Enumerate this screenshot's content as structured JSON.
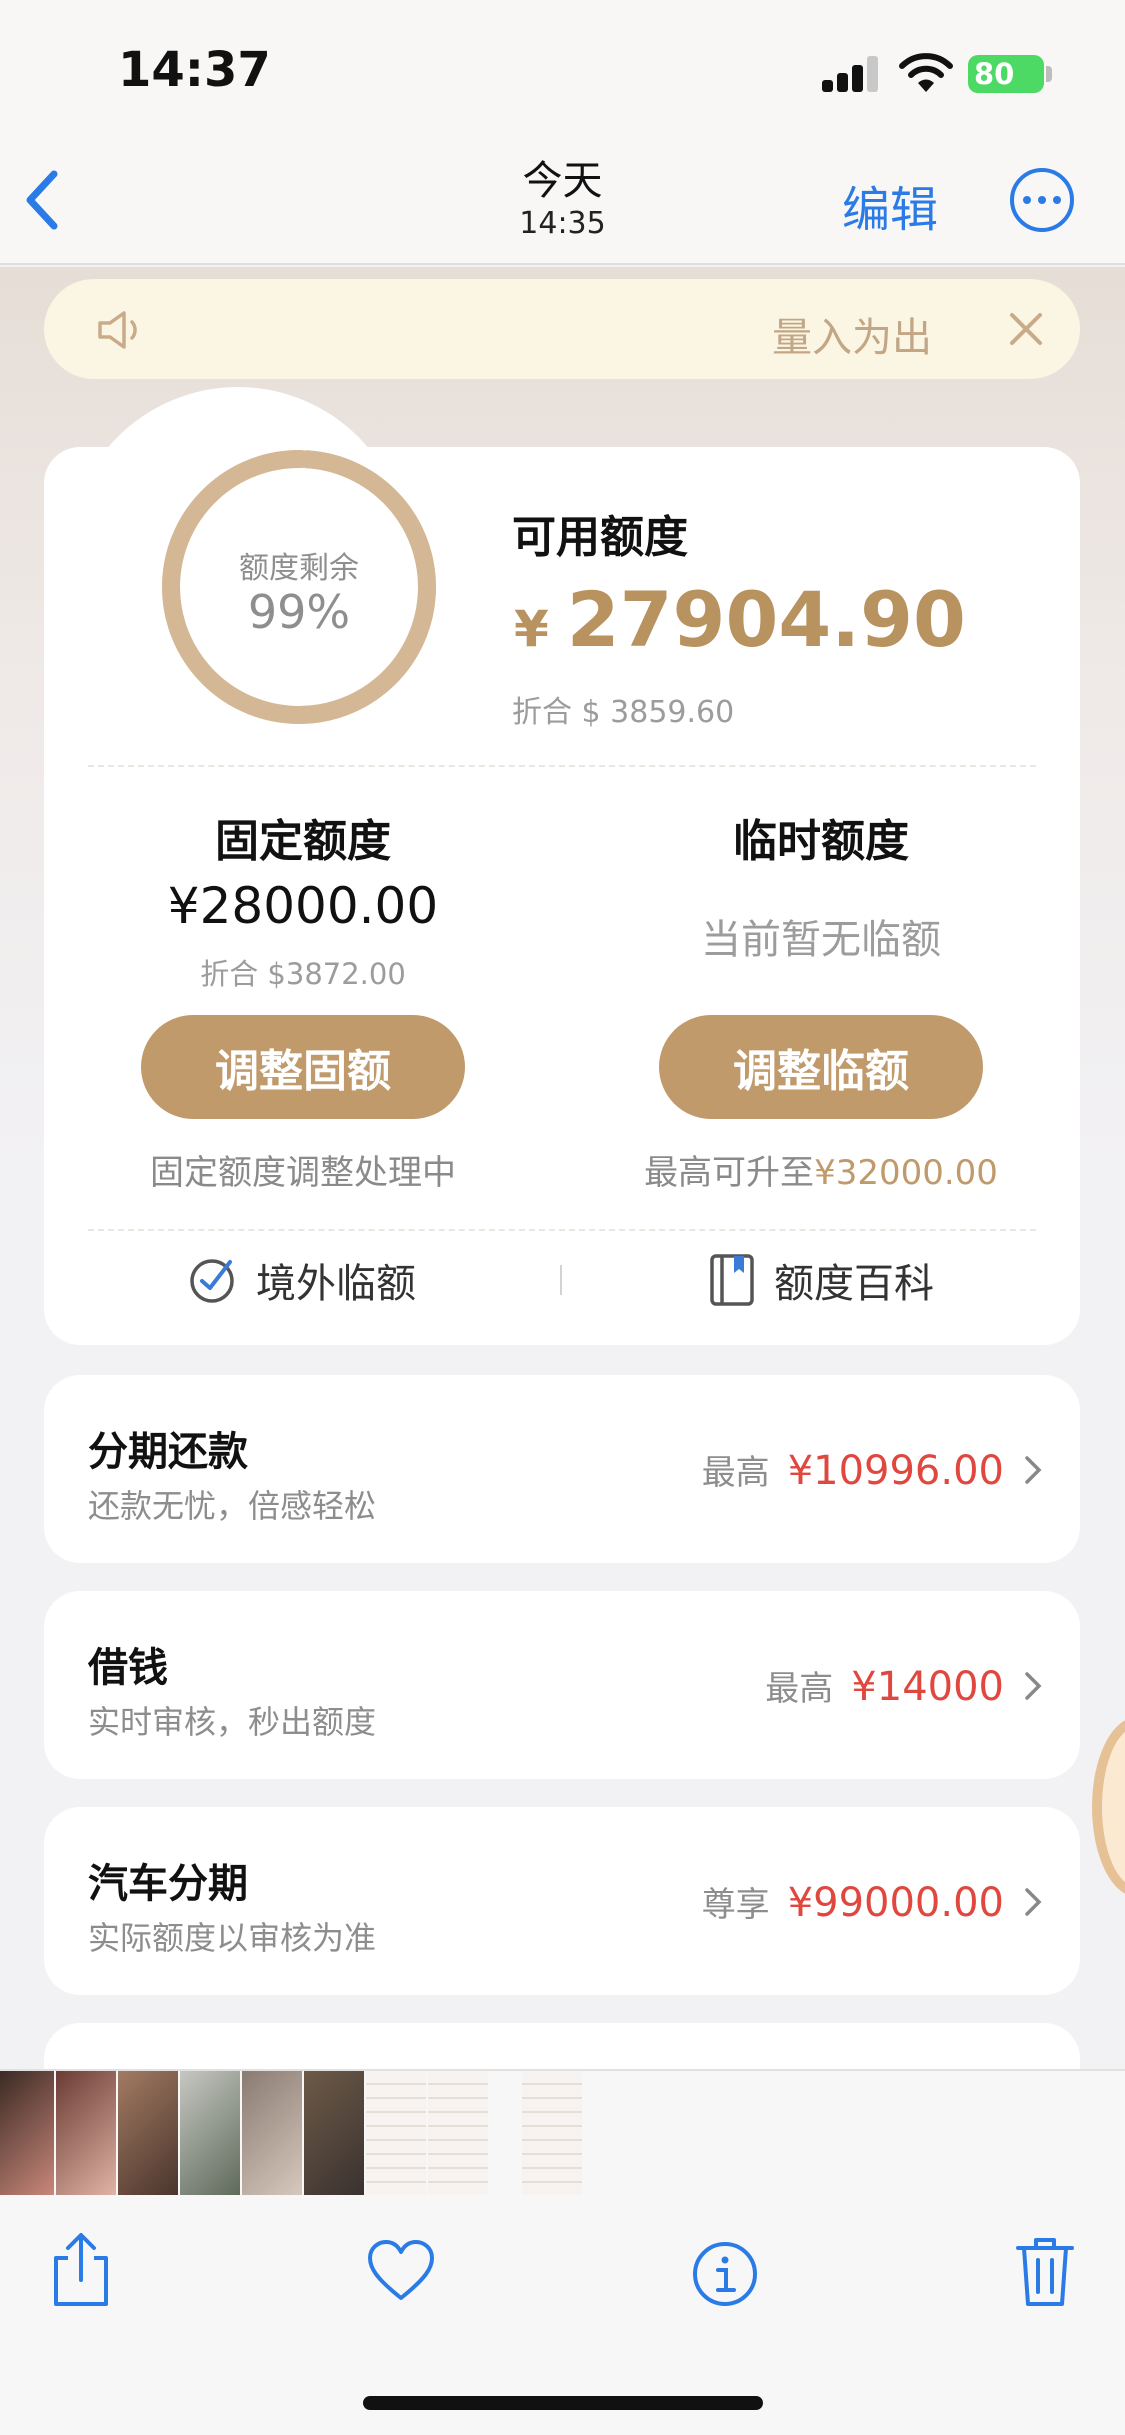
{
  "status_bar": {
    "time": "14:37",
    "battery": "80"
  },
  "nav": {
    "title": "今天",
    "subtitle": "14:35",
    "edit_label": "编辑"
  },
  "notice": {
    "text": "量入为出"
  },
  "credit": {
    "ring_label": "额度剩余",
    "ring_percent": "99%",
    "ring_fraction": 0.99,
    "available_label": "可用额度",
    "available_currency": "¥",
    "available_amount": "27904.90",
    "available_usd": "折合 $ 3859.60",
    "fixed": {
      "title": "固定额度",
      "amount": "¥28000.00",
      "usd": "折合 $3872.00",
      "button": "调整固额",
      "note": "固定额度调整处理中"
    },
    "temp": {
      "title": "临时额度",
      "none_text": "当前暂无临额",
      "button": "调整临额",
      "note_prefix": "最高可升至",
      "note_amount": "¥32000.00"
    },
    "links": [
      {
        "label": "境外临额",
        "icon": "overseas-icon"
      },
      {
        "label": "额度百科",
        "icon": "book-icon"
      }
    ]
  },
  "services": [
    {
      "title": "分期还款",
      "subtitle": "还款无忧，倍感轻松",
      "prefix": "最高",
      "amount": "¥10996.00"
    },
    {
      "title": "借钱",
      "subtitle": "实时审核，秒出额度",
      "prefix": "最高",
      "amount": "¥14000"
    },
    {
      "title": "汽车分期",
      "subtitle": "实际额度以审核为准",
      "prefix": "尊享",
      "amount": "¥99000.00"
    }
  ],
  "toolbar": [
    "share-icon",
    "heart-icon",
    "info-icon",
    "trash-icon"
  ],
  "colors": {
    "accent_gold": "#c09a6b",
    "amount_gold": "#b8925f",
    "price_red": "#e0473f",
    "ios_blue": "#2b7be6",
    "notice_bg": "#fbf5e3"
  }
}
